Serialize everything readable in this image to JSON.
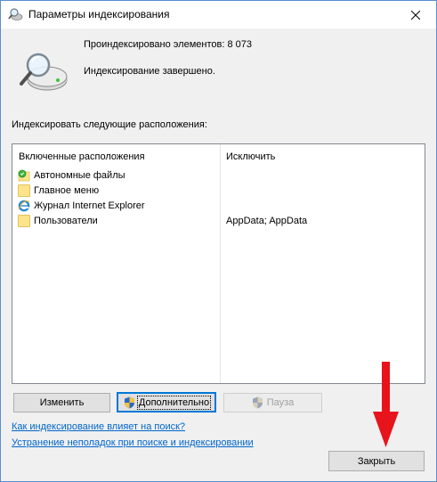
{
  "window": {
    "title": "Параметры индексирования",
    "close_glyph": "✕"
  },
  "info": {
    "count_text": "Проиндексировано элементов: 8 073",
    "status_text": "Индексирование завершено."
  },
  "locations": {
    "section_label": "Индексировать следующие расположения:",
    "col_included": "Включенные расположения",
    "col_exclude": "Исключить",
    "rows": [
      {
        "name": "Автономные файлы",
        "exclude": "",
        "icon": "offline-files-icon"
      },
      {
        "name": "Главное меню",
        "exclude": "",
        "icon": "folder-icon"
      },
      {
        "name": "Журнал Internet Explorer",
        "exclude": "",
        "icon": "internet-explorer-icon"
      },
      {
        "name": "Пользователи",
        "exclude": "AppData; AppData",
        "icon": "folder-icon"
      }
    ]
  },
  "buttons": {
    "modify": "Изменить",
    "advanced": "Дополнительно",
    "pause": "Пауза",
    "close": "Закрыть"
  },
  "links": {
    "how_affects": "Как индексирование влияет на поиск?",
    "troubleshoot": "Устранение неполадок при поиске и индексировании"
  },
  "colors": {
    "accent": "#0078d7",
    "link": "#0066cc",
    "arrow": "#e8141b"
  }
}
